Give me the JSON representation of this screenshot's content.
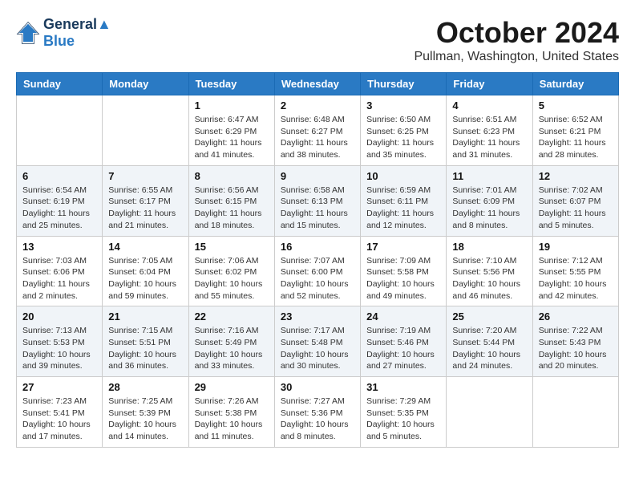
{
  "logo": {
    "line1": "General",
    "line2": "Blue"
  },
  "title": "October 2024",
  "location": "Pullman, Washington, United States",
  "weekdays": [
    "Sunday",
    "Monday",
    "Tuesday",
    "Wednesday",
    "Thursday",
    "Friday",
    "Saturday"
  ],
  "weeks": [
    [
      {
        "day": "",
        "info": ""
      },
      {
        "day": "",
        "info": ""
      },
      {
        "day": "1",
        "info": "Sunrise: 6:47 AM\nSunset: 6:29 PM\nDaylight: 11 hours and 41 minutes."
      },
      {
        "day": "2",
        "info": "Sunrise: 6:48 AM\nSunset: 6:27 PM\nDaylight: 11 hours and 38 minutes."
      },
      {
        "day": "3",
        "info": "Sunrise: 6:50 AM\nSunset: 6:25 PM\nDaylight: 11 hours and 35 minutes."
      },
      {
        "day": "4",
        "info": "Sunrise: 6:51 AM\nSunset: 6:23 PM\nDaylight: 11 hours and 31 minutes."
      },
      {
        "day": "5",
        "info": "Sunrise: 6:52 AM\nSunset: 6:21 PM\nDaylight: 11 hours and 28 minutes."
      }
    ],
    [
      {
        "day": "6",
        "info": "Sunrise: 6:54 AM\nSunset: 6:19 PM\nDaylight: 11 hours and 25 minutes."
      },
      {
        "day": "7",
        "info": "Sunrise: 6:55 AM\nSunset: 6:17 PM\nDaylight: 11 hours and 21 minutes."
      },
      {
        "day": "8",
        "info": "Sunrise: 6:56 AM\nSunset: 6:15 PM\nDaylight: 11 hours and 18 minutes."
      },
      {
        "day": "9",
        "info": "Sunrise: 6:58 AM\nSunset: 6:13 PM\nDaylight: 11 hours and 15 minutes."
      },
      {
        "day": "10",
        "info": "Sunrise: 6:59 AM\nSunset: 6:11 PM\nDaylight: 11 hours and 12 minutes."
      },
      {
        "day": "11",
        "info": "Sunrise: 7:01 AM\nSunset: 6:09 PM\nDaylight: 11 hours and 8 minutes."
      },
      {
        "day": "12",
        "info": "Sunrise: 7:02 AM\nSunset: 6:07 PM\nDaylight: 11 hours and 5 minutes."
      }
    ],
    [
      {
        "day": "13",
        "info": "Sunrise: 7:03 AM\nSunset: 6:06 PM\nDaylight: 11 hours and 2 minutes."
      },
      {
        "day": "14",
        "info": "Sunrise: 7:05 AM\nSunset: 6:04 PM\nDaylight: 10 hours and 59 minutes."
      },
      {
        "day": "15",
        "info": "Sunrise: 7:06 AM\nSunset: 6:02 PM\nDaylight: 10 hours and 55 minutes."
      },
      {
        "day": "16",
        "info": "Sunrise: 7:07 AM\nSunset: 6:00 PM\nDaylight: 10 hours and 52 minutes."
      },
      {
        "day": "17",
        "info": "Sunrise: 7:09 AM\nSunset: 5:58 PM\nDaylight: 10 hours and 49 minutes."
      },
      {
        "day": "18",
        "info": "Sunrise: 7:10 AM\nSunset: 5:56 PM\nDaylight: 10 hours and 46 minutes."
      },
      {
        "day": "19",
        "info": "Sunrise: 7:12 AM\nSunset: 5:55 PM\nDaylight: 10 hours and 42 minutes."
      }
    ],
    [
      {
        "day": "20",
        "info": "Sunrise: 7:13 AM\nSunset: 5:53 PM\nDaylight: 10 hours and 39 minutes."
      },
      {
        "day": "21",
        "info": "Sunrise: 7:15 AM\nSunset: 5:51 PM\nDaylight: 10 hours and 36 minutes."
      },
      {
        "day": "22",
        "info": "Sunrise: 7:16 AM\nSunset: 5:49 PM\nDaylight: 10 hours and 33 minutes."
      },
      {
        "day": "23",
        "info": "Sunrise: 7:17 AM\nSunset: 5:48 PM\nDaylight: 10 hours and 30 minutes."
      },
      {
        "day": "24",
        "info": "Sunrise: 7:19 AM\nSunset: 5:46 PM\nDaylight: 10 hours and 27 minutes."
      },
      {
        "day": "25",
        "info": "Sunrise: 7:20 AM\nSunset: 5:44 PM\nDaylight: 10 hours and 24 minutes."
      },
      {
        "day": "26",
        "info": "Sunrise: 7:22 AM\nSunset: 5:43 PM\nDaylight: 10 hours and 20 minutes."
      }
    ],
    [
      {
        "day": "27",
        "info": "Sunrise: 7:23 AM\nSunset: 5:41 PM\nDaylight: 10 hours and 17 minutes."
      },
      {
        "day": "28",
        "info": "Sunrise: 7:25 AM\nSunset: 5:39 PM\nDaylight: 10 hours and 14 minutes."
      },
      {
        "day": "29",
        "info": "Sunrise: 7:26 AM\nSunset: 5:38 PM\nDaylight: 10 hours and 11 minutes."
      },
      {
        "day": "30",
        "info": "Sunrise: 7:27 AM\nSunset: 5:36 PM\nDaylight: 10 hours and 8 minutes."
      },
      {
        "day": "31",
        "info": "Sunrise: 7:29 AM\nSunset: 5:35 PM\nDaylight: 10 hours and 5 minutes."
      },
      {
        "day": "",
        "info": ""
      },
      {
        "day": "",
        "info": ""
      }
    ]
  ]
}
